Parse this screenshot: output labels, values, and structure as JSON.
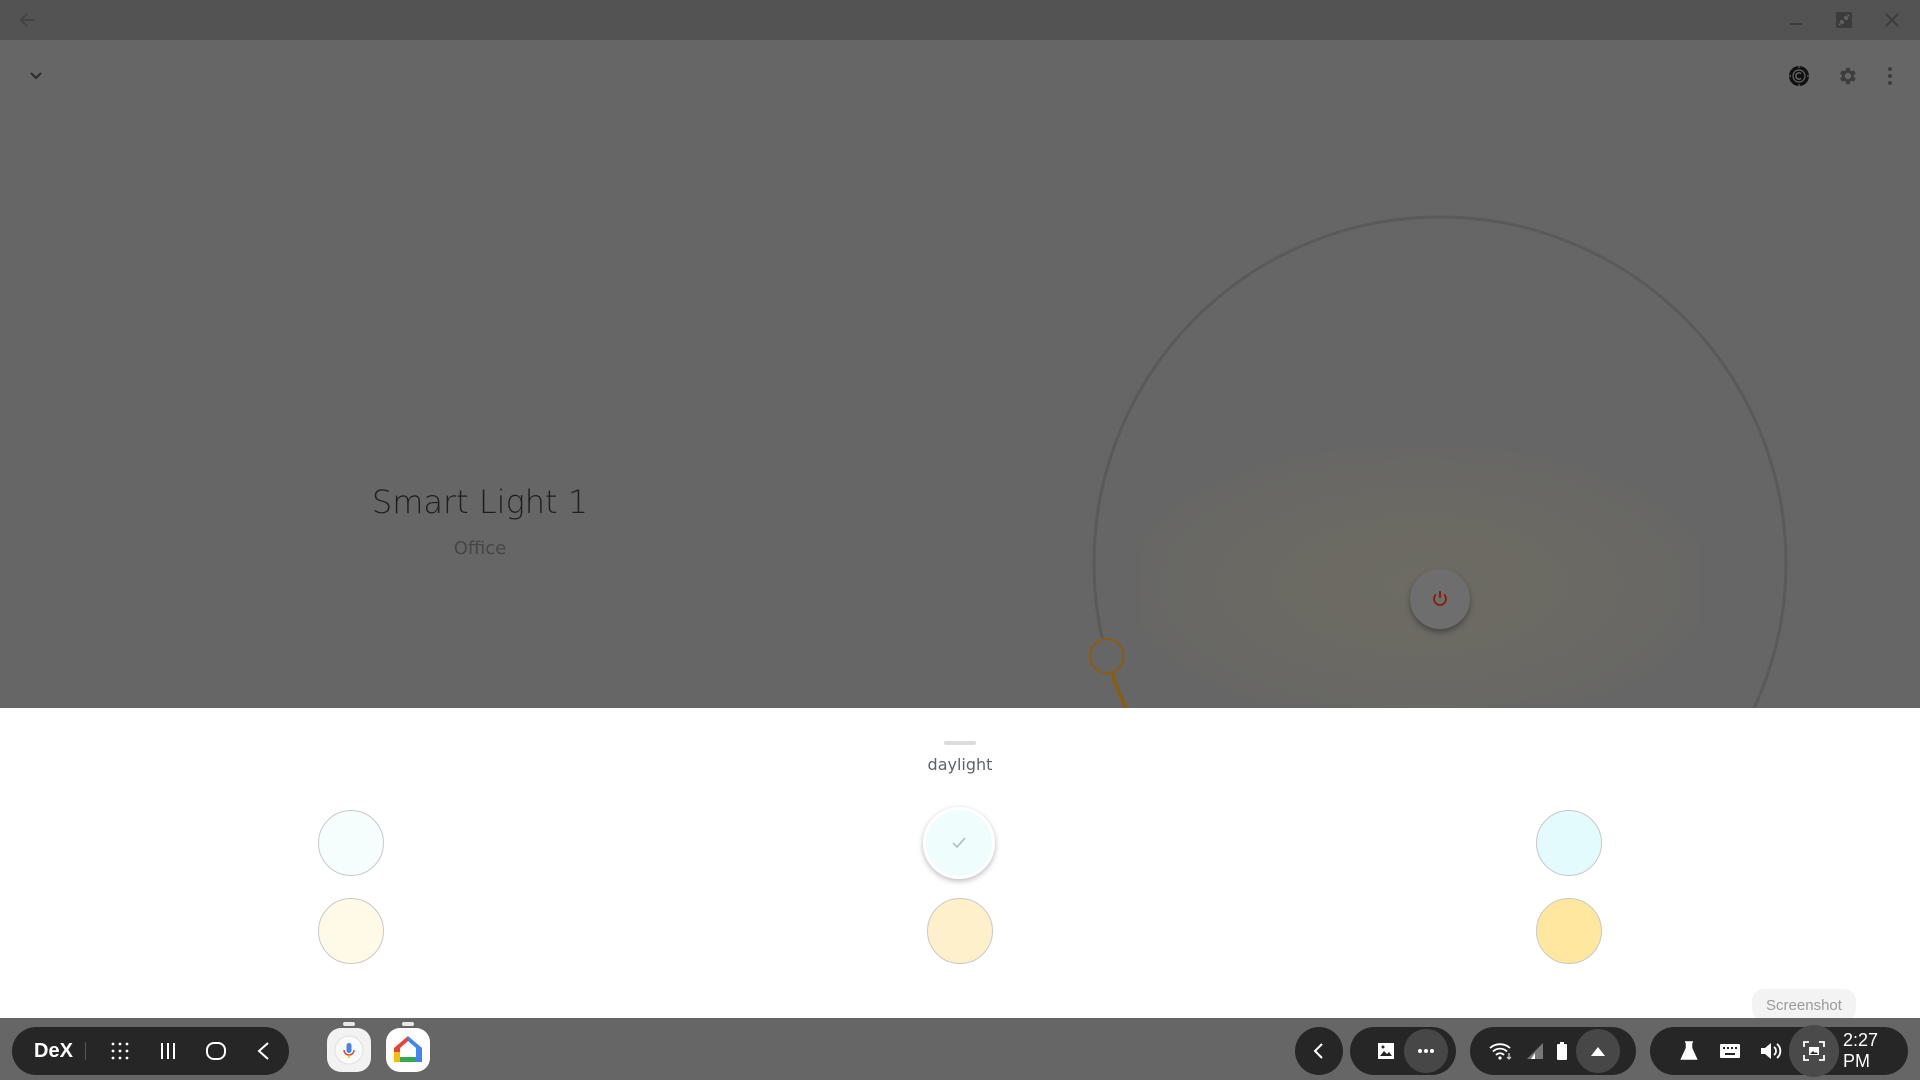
{
  "window": {
    "back_icon": "arrow-left-icon",
    "controls": [
      {
        "name": "minimize",
        "icon": "minimize-icon"
      },
      {
        "name": "restore",
        "icon": "restore-icon"
      },
      {
        "name": "close",
        "icon": "close-icon"
      }
    ]
  },
  "header": {
    "collapse_icon": "chevron-down-icon",
    "actions": [
      {
        "name": "smartthings",
        "icon": "hub-icon"
      },
      {
        "name": "settings",
        "icon": "gear-icon"
      },
      {
        "name": "more",
        "icon": "more-vert-icon"
      }
    ]
  },
  "device": {
    "name": "Smart Light 1",
    "room": "Office",
    "power_icon": "power-icon"
  },
  "dial": {
    "brightness_fraction": 0.17,
    "active_color": "#8a5d0f",
    "track_color": "#5a5a5a",
    "power_color": "#8b1a0e"
  },
  "sheet": {
    "label": "daylight",
    "swatches": [
      {
        "name": "cool-white",
        "color": "#f6fdfd",
        "selected": false
      },
      {
        "name": "daylight",
        "color": "#effdfd",
        "selected": true
      },
      {
        "name": "cool-blue",
        "color": "#e3fbfd",
        "selected": false
      },
      {
        "name": "soft-white",
        "color": "#fff9e8",
        "selected": false
      },
      {
        "name": "warm-white",
        "color": "#fff0cc",
        "selected": false
      },
      {
        "name": "warm-amber",
        "color": "#ffe7a0",
        "selected": false
      }
    ]
  },
  "taskbar": {
    "dex_label": "DeX",
    "nav": [
      {
        "name": "apps",
        "icon": "apps-grid-icon"
      },
      {
        "name": "recents",
        "icon": "recents-icon"
      },
      {
        "name": "home",
        "icon": "home-icon"
      },
      {
        "name": "back",
        "icon": "back-icon"
      }
    ],
    "pinned_apps": [
      {
        "name": "voice-assistant",
        "icon": "microphone-icon"
      },
      {
        "name": "google-home",
        "icon": "google-home-icon"
      }
    ],
    "tray": {
      "collapse_icon": "chevron-left-icon",
      "gallery_icon": "image-icon",
      "more_icon": "more-horiz-icon",
      "wifi_icon": "wifi-icon",
      "signal_icon": "signal-icon",
      "battery_icon": "battery-icon",
      "expand_icon": "triangle-up-icon",
      "labs_icon": "flask-icon",
      "keyboard_icon": "keyboard-icon",
      "volume_icon": "volume-icon",
      "screenshot_icon": "screenshot-icon",
      "time": "2:27 PM"
    },
    "tooltip": "Screenshot"
  }
}
